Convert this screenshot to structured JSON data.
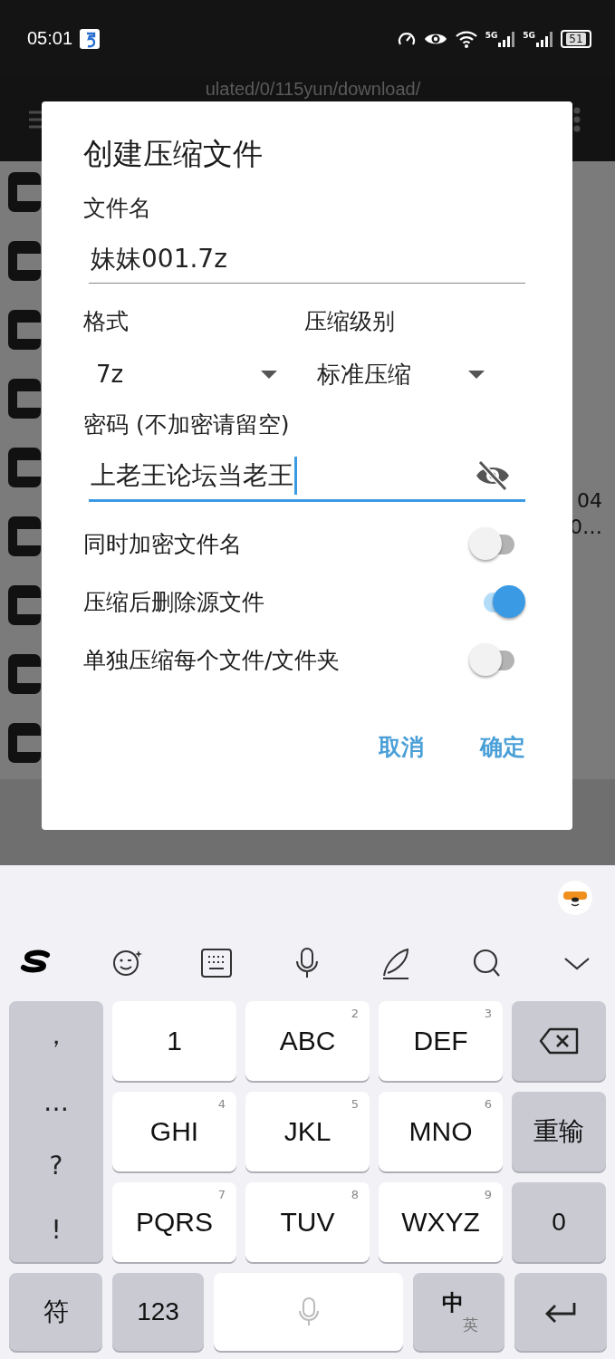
{
  "status_bar": {
    "time": "05:01",
    "network_labels": [
      "5G",
      "5G"
    ],
    "battery": "51"
  },
  "toolbar": {
    "path": "ulated/0/115yun/download/"
  },
  "background_list": {
    "side_texts": [
      "04",
      "0…"
    ]
  },
  "dialog": {
    "title": "创建压缩文件",
    "name_field": {
      "label": "文件名",
      "value": "妹妹001.7z",
      "focused": false
    },
    "dropdowns": [
      {
        "label": "格式",
        "value": "7z"
      },
      {
        "label": "压缩级别",
        "value": "标准压缩"
      }
    ],
    "password_field": {
      "label": "密码 (不加密请留空)",
      "value": "上老王论坛当老王",
      "focused": true
    },
    "switches": [
      {
        "label": "同时加密文件名",
        "on": false
      },
      {
        "label": "压缩后删除源文件",
        "on": true
      },
      {
        "label": "单独压缩每个文件/文件夹",
        "on": false
      }
    ],
    "buttons": [
      "取消",
      "确定"
    ]
  },
  "keyboard": {
    "symbols": [
      "，",
      "…",
      "?",
      "!"
    ],
    "keys": [
      {
        "kind": "letter",
        "label": "1"
      },
      {
        "kind": "letter",
        "label": "ABC",
        "hint": "2"
      },
      {
        "kind": "letter",
        "label": "DEF",
        "hint": "3"
      },
      {
        "kind": "backspace"
      },
      {
        "kind": "letter",
        "label": "GHI",
        "hint": "4"
      },
      {
        "kind": "letter",
        "label": "JKL",
        "hint": "5"
      },
      {
        "kind": "letter",
        "label": "MNO",
        "hint": "6"
      },
      {
        "kind": "function",
        "label": "重输"
      },
      {
        "kind": "letter",
        "label": "PQRS",
        "hint": "7"
      },
      {
        "kind": "letter",
        "label": "TUV",
        "hint": "8"
      },
      {
        "kind": "letter",
        "label": "WXYZ",
        "hint": "9"
      },
      {
        "kind": "function",
        "label": "0"
      }
    ],
    "bottom_keys": [
      {
        "kind": "function",
        "label": "符"
      },
      {
        "kind": "function",
        "label": "123"
      },
      {
        "kind": "space"
      },
      {
        "kind": "lang",
        "label": "中",
        "hint": "英"
      },
      {
        "kind": "enter"
      }
    ]
  }
}
